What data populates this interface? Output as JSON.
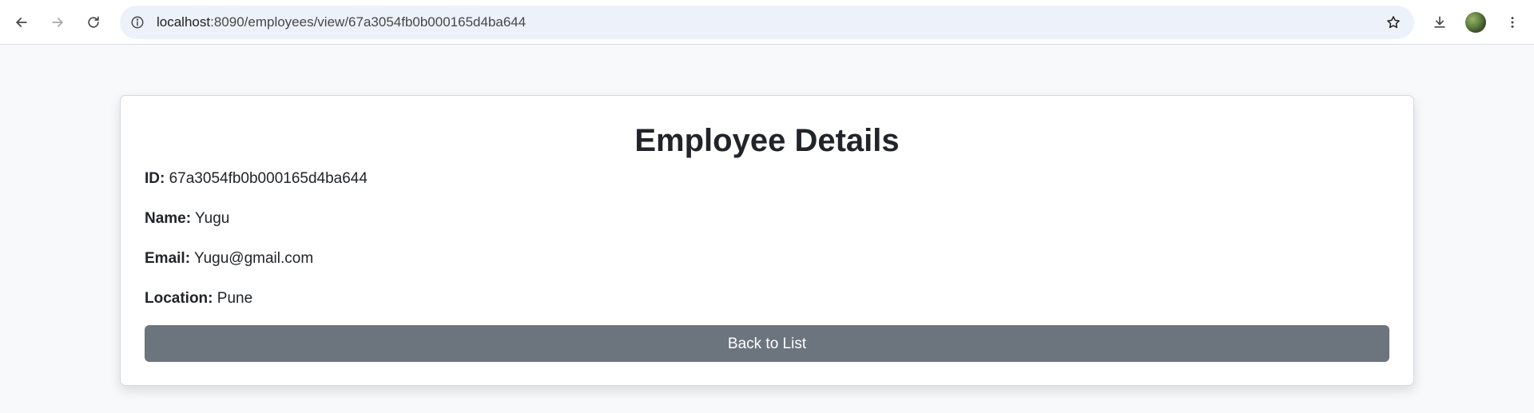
{
  "browser": {
    "url_host": "localhost",
    "url_path": ":8090/employees/view/67a3054fb0b000165d4ba644",
    "icons": {
      "back": "arrow-left-icon",
      "forward": "arrow-right-icon",
      "reload": "reload-icon",
      "site_info": "info-icon",
      "bookmark": "star-icon",
      "download": "download-icon",
      "menu": "more-vertical-icon"
    }
  },
  "page": {
    "title": "Employee Details",
    "fields": [
      {
        "label": "ID:",
        "value": "67a3054fb0b000165d4ba644"
      },
      {
        "label": "Name:",
        "value": "Yugu"
      },
      {
        "label": "Email:",
        "value": "Yugu@gmail.com"
      },
      {
        "label": "Location:",
        "value": "Pune"
      }
    ],
    "back_button_label": "Back to List"
  },
  "colors": {
    "page_background": "#f8f9fa",
    "button_background": "#6c757d",
    "button_text": "#ffffff",
    "omnibox_background": "#edf2fa"
  }
}
